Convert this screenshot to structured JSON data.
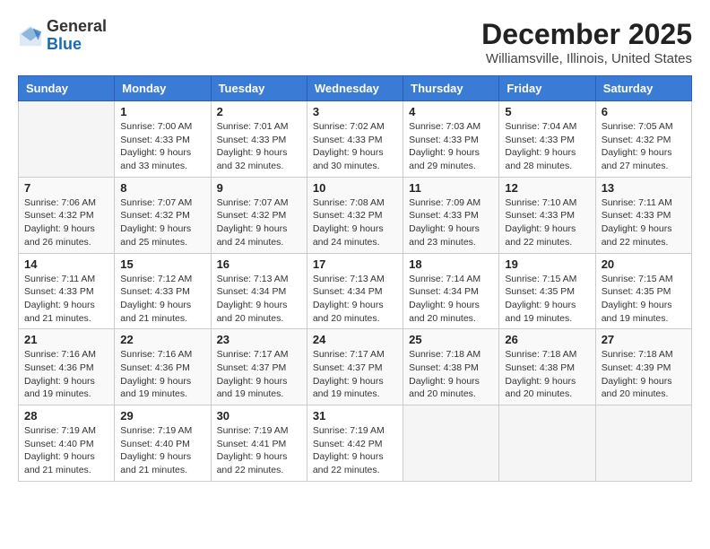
{
  "header": {
    "logo_general": "General",
    "logo_blue": "Blue",
    "month_title": "December 2025",
    "location": "Williamsville, Illinois, United States"
  },
  "weekdays": [
    "Sunday",
    "Monday",
    "Tuesday",
    "Wednesday",
    "Thursday",
    "Friday",
    "Saturday"
  ],
  "weeks": [
    [
      {
        "day": "",
        "sunrise": "",
        "sunset": "",
        "daylight": ""
      },
      {
        "day": "1",
        "sunrise": "Sunrise: 7:00 AM",
        "sunset": "Sunset: 4:33 PM",
        "daylight": "Daylight: 9 hours and 33 minutes."
      },
      {
        "day": "2",
        "sunrise": "Sunrise: 7:01 AM",
        "sunset": "Sunset: 4:33 PM",
        "daylight": "Daylight: 9 hours and 32 minutes."
      },
      {
        "day": "3",
        "sunrise": "Sunrise: 7:02 AM",
        "sunset": "Sunset: 4:33 PM",
        "daylight": "Daylight: 9 hours and 30 minutes."
      },
      {
        "day": "4",
        "sunrise": "Sunrise: 7:03 AM",
        "sunset": "Sunset: 4:33 PM",
        "daylight": "Daylight: 9 hours and 29 minutes."
      },
      {
        "day": "5",
        "sunrise": "Sunrise: 7:04 AM",
        "sunset": "Sunset: 4:33 PM",
        "daylight": "Daylight: 9 hours and 28 minutes."
      },
      {
        "day": "6",
        "sunrise": "Sunrise: 7:05 AM",
        "sunset": "Sunset: 4:32 PM",
        "daylight": "Daylight: 9 hours and 27 minutes."
      }
    ],
    [
      {
        "day": "7",
        "sunrise": "Sunrise: 7:06 AM",
        "sunset": "Sunset: 4:32 PM",
        "daylight": "Daylight: 9 hours and 26 minutes."
      },
      {
        "day": "8",
        "sunrise": "Sunrise: 7:07 AM",
        "sunset": "Sunset: 4:32 PM",
        "daylight": "Daylight: 9 hours and 25 minutes."
      },
      {
        "day": "9",
        "sunrise": "Sunrise: 7:07 AM",
        "sunset": "Sunset: 4:32 PM",
        "daylight": "Daylight: 9 hours and 24 minutes."
      },
      {
        "day": "10",
        "sunrise": "Sunrise: 7:08 AM",
        "sunset": "Sunset: 4:32 PM",
        "daylight": "Daylight: 9 hours and 24 minutes."
      },
      {
        "day": "11",
        "sunrise": "Sunrise: 7:09 AM",
        "sunset": "Sunset: 4:33 PM",
        "daylight": "Daylight: 9 hours and 23 minutes."
      },
      {
        "day": "12",
        "sunrise": "Sunrise: 7:10 AM",
        "sunset": "Sunset: 4:33 PM",
        "daylight": "Daylight: 9 hours and 22 minutes."
      },
      {
        "day": "13",
        "sunrise": "Sunrise: 7:11 AM",
        "sunset": "Sunset: 4:33 PM",
        "daylight": "Daylight: 9 hours and 22 minutes."
      }
    ],
    [
      {
        "day": "14",
        "sunrise": "Sunrise: 7:11 AM",
        "sunset": "Sunset: 4:33 PM",
        "daylight": "Daylight: 9 hours and 21 minutes."
      },
      {
        "day": "15",
        "sunrise": "Sunrise: 7:12 AM",
        "sunset": "Sunset: 4:33 PM",
        "daylight": "Daylight: 9 hours and 21 minutes."
      },
      {
        "day": "16",
        "sunrise": "Sunrise: 7:13 AM",
        "sunset": "Sunset: 4:34 PM",
        "daylight": "Daylight: 9 hours and 20 minutes."
      },
      {
        "day": "17",
        "sunrise": "Sunrise: 7:13 AM",
        "sunset": "Sunset: 4:34 PM",
        "daylight": "Daylight: 9 hours and 20 minutes."
      },
      {
        "day": "18",
        "sunrise": "Sunrise: 7:14 AM",
        "sunset": "Sunset: 4:34 PM",
        "daylight": "Daylight: 9 hours and 20 minutes."
      },
      {
        "day": "19",
        "sunrise": "Sunrise: 7:15 AM",
        "sunset": "Sunset: 4:35 PM",
        "daylight": "Daylight: 9 hours and 19 minutes."
      },
      {
        "day": "20",
        "sunrise": "Sunrise: 7:15 AM",
        "sunset": "Sunset: 4:35 PM",
        "daylight": "Daylight: 9 hours and 19 minutes."
      }
    ],
    [
      {
        "day": "21",
        "sunrise": "Sunrise: 7:16 AM",
        "sunset": "Sunset: 4:36 PM",
        "daylight": "Daylight: 9 hours and 19 minutes."
      },
      {
        "day": "22",
        "sunrise": "Sunrise: 7:16 AM",
        "sunset": "Sunset: 4:36 PM",
        "daylight": "Daylight: 9 hours and 19 minutes."
      },
      {
        "day": "23",
        "sunrise": "Sunrise: 7:17 AM",
        "sunset": "Sunset: 4:37 PM",
        "daylight": "Daylight: 9 hours and 19 minutes."
      },
      {
        "day": "24",
        "sunrise": "Sunrise: 7:17 AM",
        "sunset": "Sunset: 4:37 PM",
        "daylight": "Daylight: 9 hours and 19 minutes."
      },
      {
        "day": "25",
        "sunrise": "Sunrise: 7:18 AM",
        "sunset": "Sunset: 4:38 PM",
        "daylight": "Daylight: 9 hours and 20 minutes."
      },
      {
        "day": "26",
        "sunrise": "Sunrise: 7:18 AM",
        "sunset": "Sunset: 4:38 PM",
        "daylight": "Daylight: 9 hours and 20 minutes."
      },
      {
        "day": "27",
        "sunrise": "Sunrise: 7:18 AM",
        "sunset": "Sunset: 4:39 PM",
        "daylight": "Daylight: 9 hours and 20 minutes."
      }
    ],
    [
      {
        "day": "28",
        "sunrise": "Sunrise: 7:19 AM",
        "sunset": "Sunset: 4:40 PM",
        "daylight": "Daylight: 9 hours and 21 minutes."
      },
      {
        "day": "29",
        "sunrise": "Sunrise: 7:19 AM",
        "sunset": "Sunset: 4:40 PM",
        "daylight": "Daylight: 9 hours and 21 minutes."
      },
      {
        "day": "30",
        "sunrise": "Sunrise: 7:19 AM",
        "sunset": "Sunset: 4:41 PM",
        "daylight": "Daylight: 9 hours and 22 minutes."
      },
      {
        "day": "31",
        "sunrise": "Sunrise: 7:19 AM",
        "sunset": "Sunset: 4:42 PM",
        "daylight": "Daylight: 9 hours and 22 minutes."
      },
      {
        "day": "",
        "sunrise": "",
        "sunset": "",
        "daylight": ""
      },
      {
        "day": "",
        "sunrise": "",
        "sunset": "",
        "daylight": ""
      },
      {
        "day": "",
        "sunrise": "",
        "sunset": "",
        "daylight": ""
      }
    ]
  ]
}
